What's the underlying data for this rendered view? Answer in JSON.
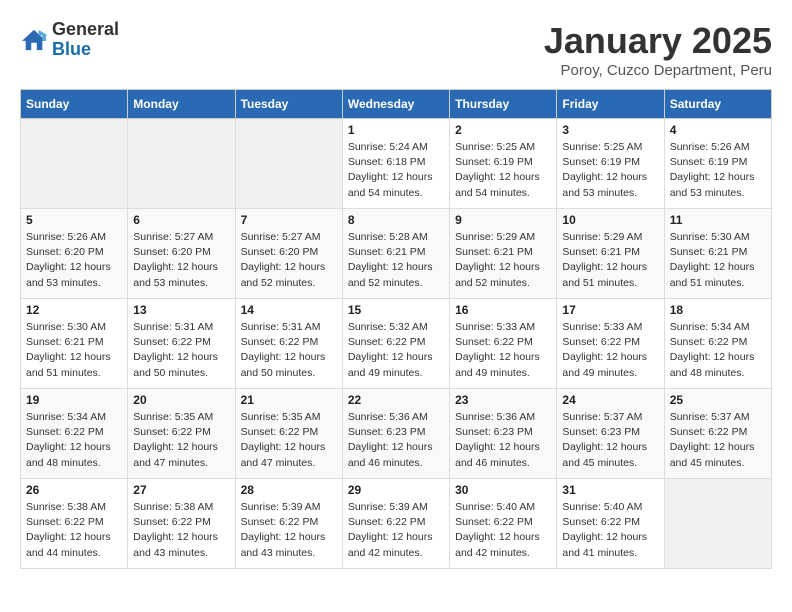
{
  "header": {
    "logo_general": "General",
    "logo_blue": "Blue",
    "title": "January 2025",
    "subtitle": "Poroy, Cuzco Department, Peru"
  },
  "days_of_week": [
    "Sunday",
    "Monday",
    "Tuesday",
    "Wednesday",
    "Thursday",
    "Friday",
    "Saturday"
  ],
  "weeks": [
    [
      {
        "day": "",
        "info": ""
      },
      {
        "day": "",
        "info": ""
      },
      {
        "day": "",
        "info": ""
      },
      {
        "day": "1",
        "info": "Sunrise: 5:24 AM\nSunset: 6:18 PM\nDaylight: 12 hours\nand 54 minutes."
      },
      {
        "day": "2",
        "info": "Sunrise: 5:25 AM\nSunset: 6:19 PM\nDaylight: 12 hours\nand 54 minutes."
      },
      {
        "day": "3",
        "info": "Sunrise: 5:25 AM\nSunset: 6:19 PM\nDaylight: 12 hours\nand 53 minutes."
      },
      {
        "day": "4",
        "info": "Sunrise: 5:26 AM\nSunset: 6:19 PM\nDaylight: 12 hours\nand 53 minutes."
      }
    ],
    [
      {
        "day": "5",
        "info": "Sunrise: 5:26 AM\nSunset: 6:20 PM\nDaylight: 12 hours\nand 53 minutes."
      },
      {
        "day": "6",
        "info": "Sunrise: 5:27 AM\nSunset: 6:20 PM\nDaylight: 12 hours\nand 53 minutes."
      },
      {
        "day": "7",
        "info": "Sunrise: 5:27 AM\nSunset: 6:20 PM\nDaylight: 12 hours\nand 52 minutes."
      },
      {
        "day": "8",
        "info": "Sunrise: 5:28 AM\nSunset: 6:21 PM\nDaylight: 12 hours\nand 52 minutes."
      },
      {
        "day": "9",
        "info": "Sunrise: 5:29 AM\nSunset: 6:21 PM\nDaylight: 12 hours\nand 52 minutes."
      },
      {
        "day": "10",
        "info": "Sunrise: 5:29 AM\nSunset: 6:21 PM\nDaylight: 12 hours\nand 51 minutes."
      },
      {
        "day": "11",
        "info": "Sunrise: 5:30 AM\nSunset: 6:21 PM\nDaylight: 12 hours\nand 51 minutes."
      }
    ],
    [
      {
        "day": "12",
        "info": "Sunrise: 5:30 AM\nSunset: 6:21 PM\nDaylight: 12 hours\nand 51 minutes."
      },
      {
        "day": "13",
        "info": "Sunrise: 5:31 AM\nSunset: 6:22 PM\nDaylight: 12 hours\nand 50 minutes."
      },
      {
        "day": "14",
        "info": "Sunrise: 5:31 AM\nSunset: 6:22 PM\nDaylight: 12 hours\nand 50 minutes."
      },
      {
        "day": "15",
        "info": "Sunrise: 5:32 AM\nSunset: 6:22 PM\nDaylight: 12 hours\nand 49 minutes."
      },
      {
        "day": "16",
        "info": "Sunrise: 5:33 AM\nSunset: 6:22 PM\nDaylight: 12 hours\nand 49 minutes."
      },
      {
        "day": "17",
        "info": "Sunrise: 5:33 AM\nSunset: 6:22 PM\nDaylight: 12 hours\nand 49 minutes."
      },
      {
        "day": "18",
        "info": "Sunrise: 5:34 AM\nSunset: 6:22 PM\nDaylight: 12 hours\nand 48 minutes."
      }
    ],
    [
      {
        "day": "19",
        "info": "Sunrise: 5:34 AM\nSunset: 6:22 PM\nDaylight: 12 hours\nand 48 minutes."
      },
      {
        "day": "20",
        "info": "Sunrise: 5:35 AM\nSunset: 6:22 PM\nDaylight: 12 hours\nand 47 minutes."
      },
      {
        "day": "21",
        "info": "Sunrise: 5:35 AM\nSunset: 6:22 PM\nDaylight: 12 hours\nand 47 minutes."
      },
      {
        "day": "22",
        "info": "Sunrise: 5:36 AM\nSunset: 6:23 PM\nDaylight: 12 hours\nand 46 minutes."
      },
      {
        "day": "23",
        "info": "Sunrise: 5:36 AM\nSunset: 6:23 PM\nDaylight: 12 hours\nand 46 minutes."
      },
      {
        "day": "24",
        "info": "Sunrise: 5:37 AM\nSunset: 6:23 PM\nDaylight: 12 hours\nand 45 minutes."
      },
      {
        "day": "25",
        "info": "Sunrise: 5:37 AM\nSunset: 6:22 PM\nDaylight: 12 hours\nand 45 minutes."
      }
    ],
    [
      {
        "day": "26",
        "info": "Sunrise: 5:38 AM\nSunset: 6:22 PM\nDaylight: 12 hours\nand 44 minutes."
      },
      {
        "day": "27",
        "info": "Sunrise: 5:38 AM\nSunset: 6:22 PM\nDaylight: 12 hours\nand 43 minutes."
      },
      {
        "day": "28",
        "info": "Sunrise: 5:39 AM\nSunset: 6:22 PM\nDaylight: 12 hours\nand 43 minutes."
      },
      {
        "day": "29",
        "info": "Sunrise: 5:39 AM\nSunset: 6:22 PM\nDaylight: 12 hours\nand 42 minutes."
      },
      {
        "day": "30",
        "info": "Sunrise: 5:40 AM\nSunset: 6:22 PM\nDaylight: 12 hours\nand 42 minutes."
      },
      {
        "day": "31",
        "info": "Sunrise: 5:40 AM\nSunset: 6:22 PM\nDaylight: 12 hours\nand 41 minutes."
      },
      {
        "day": "",
        "info": ""
      }
    ]
  ]
}
